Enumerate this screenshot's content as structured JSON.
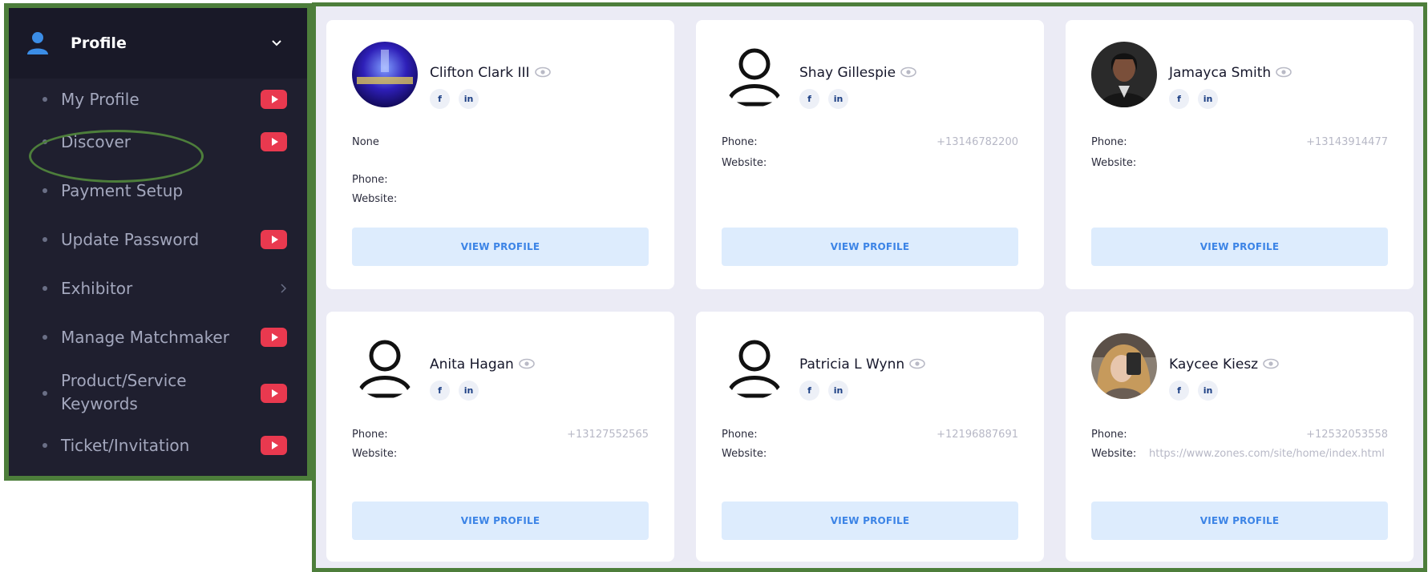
{
  "sidebar": {
    "title": "Profile",
    "items": [
      {
        "label": "My Profile",
        "video": true
      },
      {
        "label": "Discover",
        "video": true
      },
      {
        "label": "Payment Setup",
        "video": false
      },
      {
        "label": "Update Password",
        "video": true
      },
      {
        "label": "Exhibitor",
        "video": false,
        "arrow": true
      },
      {
        "label": "Manage Matchmaker",
        "video": true
      },
      {
        "label_line1": "Product/Service",
        "label_line2": "Keywords",
        "video": true
      },
      {
        "label": "Ticket/Invitation",
        "video": true
      }
    ]
  },
  "cards": [
    {
      "name": "Clifton Clark III",
      "avatar": "photo-logo",
      "note": "None",
      "phone_label": "Phone:",
      "phone": "",
      "website_label": "Website:",
      "website": "",
      "button": "VIEW PROFILE"
    },
    {
      "name": "Shay Gillespie",
      "avatar": "default-user-icon",
      "phone_label": "Phone:",
      "phone": "+13146782200",
      "website_label": "Website:",
      "website": "",
      "button": "VIEW PROFILE"
    },
    {
      "name": "Jamayca Smith",
      "avatar": "photo-person",
      "phone_label": "Phone:",
      "phone": "+13143914477",
      "website_label": "Website:",
      "website": "",
      "button": "VIEW PROFILE"
    },
    {
      "name": "Anita Hagan",
      "avatar": "default-user-icon",
      "phone_label": "Phone:",
      "phone": "+13127552565",
      "website_label": "Website:",
      "website": "",
      "button": "VIEW PROFILE"
    },
    {
      "name": "Patricia L Wynn",
      "avatar": "default-user-icon",
      "phone_label": "Phone:",
      "phone": "+12196887691",
      "website_label": "Website:",
      "website": "",
      "button": "VIEW PROFILE"
    },
    {
      "name": "Kaycee Kiesz",
      "avatar": "photo-person",
      "phone_label": "Phone:",
      "phone": "+12532053558",
      "website_label": "Website:",
      "website": "https://www.zones.com/site/home/index.html",
      "button": "VIEW PROFILE"
    }
  ],
  "social": {
    "facebook": "f",
    "linkedin": "in"
  },
  "colors": {
    "sidebar_bg": "#1f1f2f",
    "accent_green": "#4d7e3b",
    "button_bg": "#ddecfd",
    "button_text": "#3c84e6",
    "video_red": "#e9394f"
  }
}
